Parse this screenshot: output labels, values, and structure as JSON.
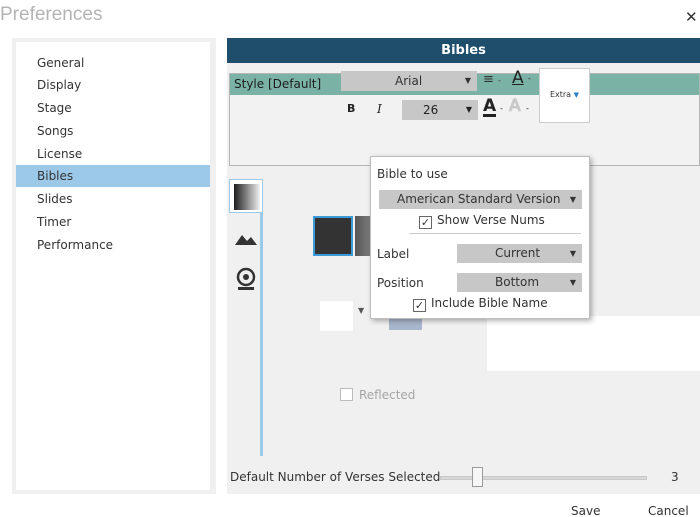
{
  "window": {
    "title": "Preferences",
    "close_glyph": "✕"
  },
  "sidebar": {
    "items": [
      {
        "label": "General"
      },
      {
        "label": "Display"
      },
      {
        "label": "Stage"
      },
      {
        "label": "Songs"
      },
      {
        "label": "License"
      },
      {
        "label": "Bibles",
        "active": true
      },
      {
        "label": "Slides"
      },
      {
        "label": "Timer"
      },
      {
        "label": "Performance"
      }
    ]
  },
  "main": {
    "header": "Bibles",
    "style_panel": {
      "title": "Style [Default]",
      "font": "Arial",
      "size": "26",
      "bold": "B",
      "italic": "I",
      "extra": "Extra"
    },
    "reflected": "Reflected",
    "default_verses": {
      "label": "Default Number of Verses Selected",
      "value": "3",
      "fraction": 0.1
    }
  },
  "popup": {
    "bible_to_use_label": "Bible to use",
    "bible": "American Standard Version",
    "show_verse_nums": "Show Verse Nums",
    "label_label": "Label",
    "label_value": "Current",
    "position_label": "Position",
    "position_value": "Bottom",
    "include_bible_name": "Include Bible Name",
    "check_glyph": "✓"
  },
  "footer": {
    "save": "Save",
    "cancel": "Cancel"
  },
  "colors": {
    "header": "#1f4e6d",
    "style_header": "#7ab3a6",
    "selection": "#9cc9ea",
    "accent": "#3a9bd8"
  }
}
